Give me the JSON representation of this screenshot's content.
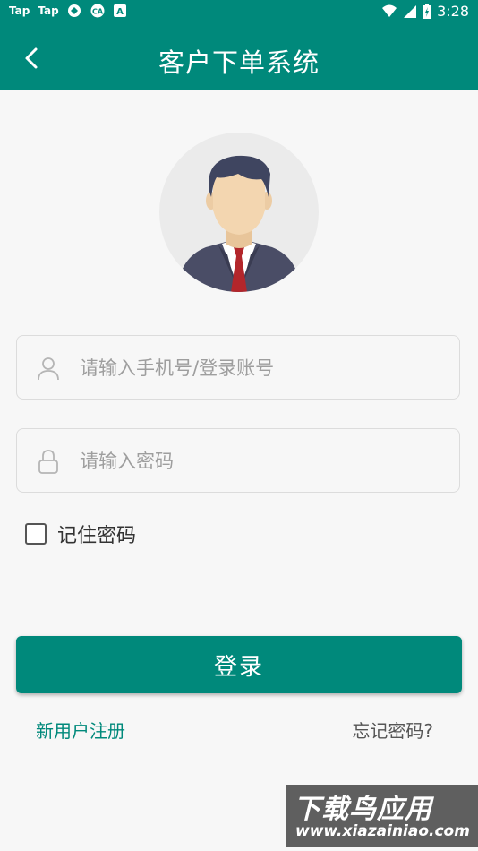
{
  "status_bar": {
    "left_items": [
      "Tap",
      "Tap"
    ],
    "left_icons": [
      "app-icon-1",
      "cat-icon",
      "a-icon"
    ],
    "time": "3:28",
    "right_icons": [
      "wifi-icon",
      "signal-icon",
      "battery-icon"
    ]
  },
  "app_bar": {
    "title": "客户下单系统",
    "back_icon": "chevron-left-icon"
  },
  "login_form": {
    "account_placeholder": "请输入手机号/登录账号",
    "account_value": "",
    "password_placeholder": "请输入密码",
    "password_value": "",
    "remember_label": "记住密码",
    "remember_checked": false,
    "login_label": "登录",
    "register_label": "新用户注册",
    "forgot_label": "忘记密码?"
  },
  "watermark": {
    "title": "下载鸟应用",
    "url": "www.xiazainiao.com"
  },
  "colors": {
    "primary": "#00897b",
    "background": "#f7f7f7"
  }
}
